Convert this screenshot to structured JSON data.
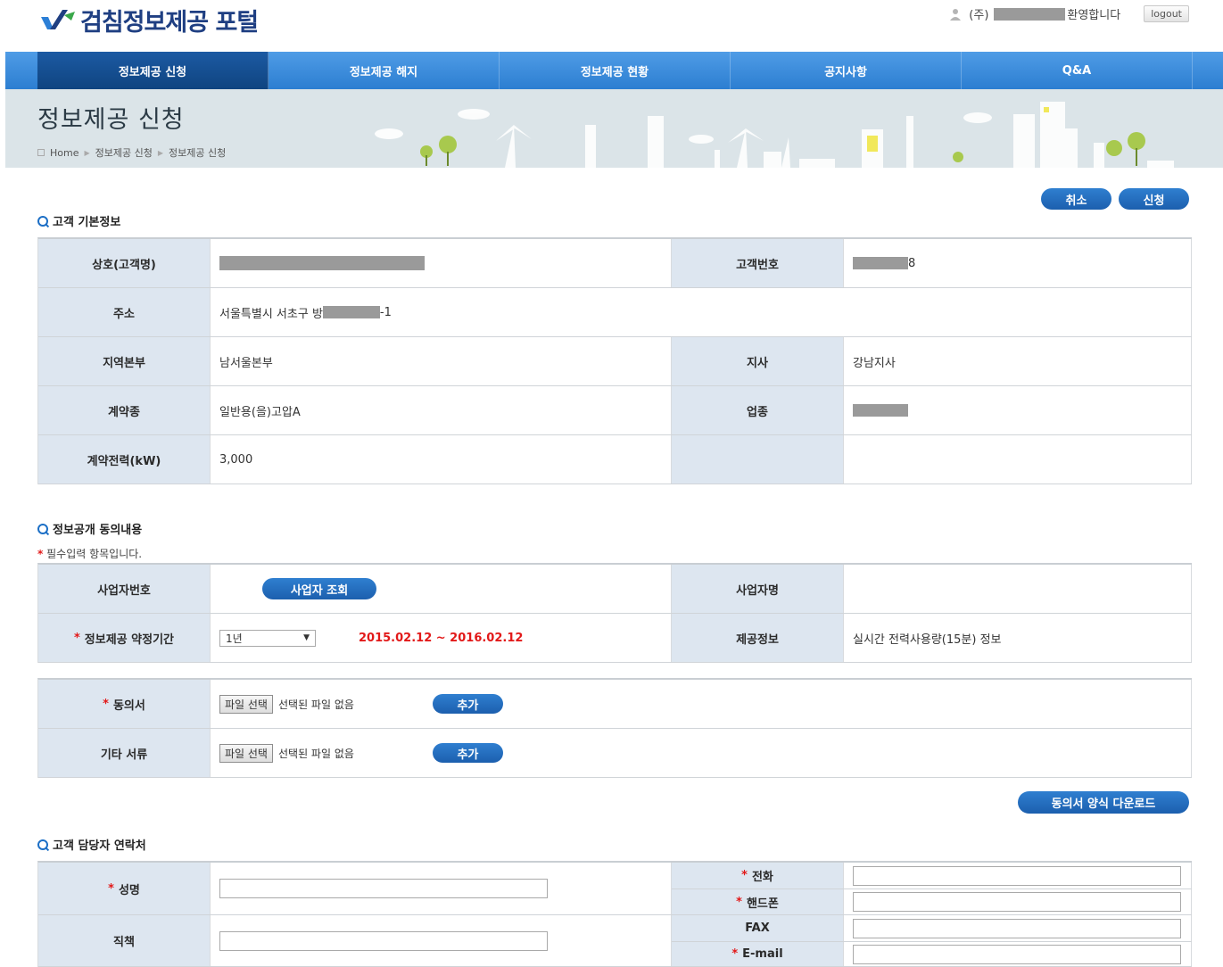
{
  "header": {
    "logo_text": "검침정보제공 포털",
    "user_prefix": "(주)",
    "user_suffix": "환영합니다",
    "logout_label": "logout"
  },
  "nav": {
    "items": [
      {
        "label": "정보제공 신청",
        "active": true
      },
      {
        "label": "정보제공 해지",
        "active": false
      },
      {
        "label": "정보제공 현황",
        "active": false
      },
      {
        "label": "공지사항",
        "active": false
      },
      {
        "label": "Q&A",
        "active": false
      }
    ]
  },
  "banner": {
    "title": "정보제공 신청",
    "breadcrumb": [
      "Home",
      "정보제공 신청",
      "정보제공 신청"
    ]
  },
  "actions": {
    "cancel_label": "취소",
    "submit_label": "신청"
  },
  "customer_info": {
    "section_title": "고객 기본정보",
    "name_label": "상호(고객명)",
    "number_label": "고객번호",
    "number_suffix": "8",
    "address_label": "주소",
    "address_prefix": "서울특별시 서초구 방",
    "address_suffix": "-1",
    "region_label": "지역본부",
    "region_value": "남서울본부",
    "branch_label": "지사",
    "branch_value": "강남지사",
    "contract_type_label": "계약종",
    "contract_type_value": "일반용(을)고압A",
    "industry_label": "업종",
    "power_label": "계약전력(kW)",
    "power_value": "3,000"
  },
  "consent": {
    "section_title": "정보공개 동의내용",
    "required_note": "필수입력 항목입니다.",
    "required_mark": "*",
    "biz_no_label": "사업자번호",
    "biz_lookup_label": "사업자 조회",
    "biz_name_label": "사업자명",
    "period_label": "정보제공 약정기간",
    "period_select_value": "1년",
    "period_range": "2015.02.12 ~ 2016.02.12",
    "provided_info_label": "제공정보",
    "provided_info_value": "실시간 전력사용량(15분) 정보",
    "consent_form_label": "동의서",
    "other_docs_label": "기타 서류",
    "file_button_label": "파일 선택",
    "file_none_text": "선택된 파일 없음",
    "add_label": "추가",
    "download_label": "동의서 양식 다운로드"
  },
  "contact": {
    "section_title": "고객 담당자 연락처",
    "name_label": "성명",
    "position_label": "직책",
    "phone_label": "전화",
    "mobile_label": "핸드폰",
    "fax_label": "FAX",
    "email_label": "E-mail"
  }
}
